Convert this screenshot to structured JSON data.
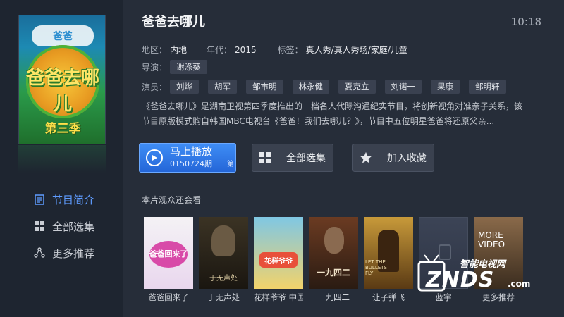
{
  "sidebar": {
    "poster": {
      "top_text": "爸爸",
      "title": "爸爸去哪儿",
      "season": "第三季"
    },
    "items": [
      {
        "label": "节目简介",
        "icon": "document-icon",
        "active": true
      },
      {
        "label": "全部选集",
        "icon": "grid-icon",
        "active": false
      },
      {
        "label": "更多推荐",
        "icon": "share-icon",
        "active": false
      }
    ]
  },
  "header": {
    "title": "爸爸去哪儿",
    "clock": "10:18"
  },
  "meta": {
    "region_label": "地区：",
    "region": "内地",
    "year_label": "年代：",
    "year": "2015",
    "tags_label": "标签：",
    "tags": "真人秀/真人秀场/家庭/儿童",
    "director_label": "导演：",
    "directors": [
      "谢涤葵"
    ],
    "cast_label": "演员：",
    "cast": [
      "刘烨",
      "胡军",
      "邹市明",
      "林永健",
      "夏克立",
      "刘诺一",
      "果康",
      "邹明轩"
    ]
  },
  "description": {
    "line1": "《爸爸去哪儿》是湖南卫视第四季度推出的一档名人代际沟通纪实节目，将创新视角对准亲子关系，该",
    "line2": "节目原版模式购自韩国MBC电视台《爸爸！我们去哪儿？》，节目中五位明星爸爸将还原父亲..."
  },
  "buttons": {
    "play_label": "马上播放",
    "play_sub": "0150724期",
    "play_edge": "第",
    "episodes_label": "全部选集",
    "favorite_label": "加入收藏"
  },
  "recommend": {
    "title": "本片观众还会看",
    "items": [
      {
        "caption": "爸爸回来了",
        "color_top": "#f4f2f5",
        "color_bottom": "#e9d7ee",
        "poster_text": "爸爸回来了"
      },
      {
        "caption": "于无声处",
        "color_top": "#3b3324",
        "color_bottom": "#1a1610",
        "poster_text": "于无声处"
      },
      {
        "caption": "花样爷爷 中国",
        "color_top": "#7fc7e4",
        "color_bottom": "#f2d36b",
        "poster_text": "花样爷爷"
      },
      {
        "caption": "一九四二",
        "color_top": "#6b3b22",
        "color_bottom": "#2a1b12",
        "poster_text": "一九四二"
      },
      {
        "caption": "让子弹飞",
        "color_top": "#c89a3a",
        "color_bottom": "#5a3a14",
        "poster_text": "LET THE BULLETS FLY"
      },
      {
        "caption": "蓝宇",
        "color_top": "#3c4456",
        "color_bottom": "#2e3545",
        "poster_text": ""
      },
      {
        "caption": "更多推荐",
        "color_top": "#8a6a4a",
        "color_bottom": "#3a2c1e",
        "poster_text": "MORE VIDEO"
      }
    ]
  },
  "watermark": {
    "line1": "智能电视网",
    "line2": "ZNDS",
    "line3": ".com"
  }
}
